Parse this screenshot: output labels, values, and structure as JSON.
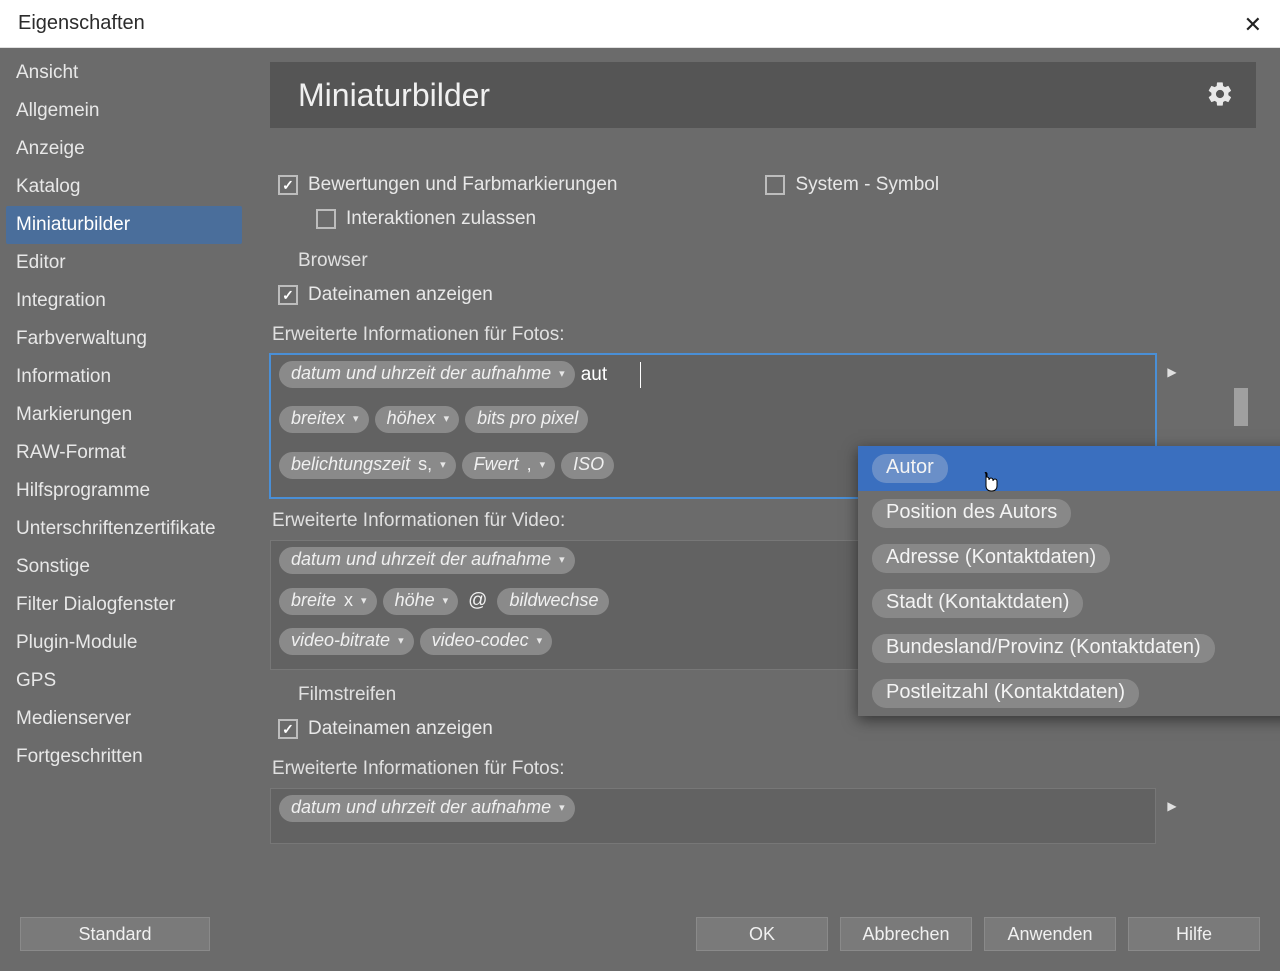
{
  "window": {
    "title": "Eigenschaften"
  },
  "sidebar": {
    "items": [
      "Ansicht",
      "Allgemein",
      "Anzeige",
      "Katalog",
      "Miniaturbilder",
      "Editor",
      "Integration",
      "Farbverwaltung",
      "Information",
      "Markierungen",
      "RAW-Format",
      "Hilfsprogramme",
      "Unterschriftenzertifikate",
      "Sonstige",
      "Filter Dialogfenster",
      "Plugin-Module",
      "GPS",
      "Medienserver",
      "Fortgeschritten"
    ],
    "selected_index": 4
  },
  "panel": {
    "title": "Miniaturbilder"
  },
  "options": {
    "ratings_label": "Bewertungen und Farbmarkierungen",
    "system_symbol_label": "System - Symbol",
    "allow_interactions_label": "Interaktionen zulassen"
  },
  "browser": {
    "section": "Browser",
    "show_filenames": "Dateinamen anzeigen",
    "photos_label": "Erweiterte Informationen für Fotos:",
    "video_label": "Erweiterte Informationen für Video:",
    "input_value": "aut",
    "photo_tags_row1": [
      "datum und uhrzeit der aufnahme"
    ],
    "photo_tags_row2": [
      "breitex",
      "höhex",
      "bits pro pixel"
    ],
    "photo_tags_row3": [
      {
        "text": "belichtungszeit",
        "suffix": " s,"
      },
      {
        "text": "Fwert",
        "suffix": ","
      },
      {
        "text": "ISO"
      }
    ],
    "video_tags_row1": [
      "datum und uhrzeit der aufnahme"
    ],
    "video_tags_row2": [
      {
        "text": "breite",
        "suffix": " x"
      },
      {
        "text": "höhe"
      },
      {
        "plain": "@"
      },
      {
        "text": "bildwechse"
      }
    ],
    "video_tags_row3": [
      "video-bitrate",
      "video-codec"
    ]
  },
  "filmstrip": {
    "section": "Filmstreifen",
    "show_filenames": "Dateinamen anzeigen",
    "photos_label": "Erweiterte Informationen für Fotos:",
    "tags": [
      "datum und uhrzeit der aufnahme"
    ]
  },
  "autocomplete": {
    "items": [
      {
        "label": "Autor",
        "category": "Autor"
      },
      {
        "label": "Position des Autors",
        "category": "Autor"
      },
      {
        "label": "Adresse (Kontaktdaten)",
        "category": "Autor"
      },
      {
        "label": "Stadt (Kontaktdaten)",
        "category": "Autor"
      },
      {
        "label": "Bundesland/Provinz (Kontaktdaten)",
        "category": "Autor"
      },
      {
        "label": "Postleitzahl (Kontaktdaten)",
        "category": "Autor"
      }
    ],
    "selected_index": 0
  },
  "footer": {
    "standard": "Standard",
    "ok": "OK",
    "cancel": "Abbrechen",
    "apply": "Anwenden",
    "help": "Hilfe"
  }
}
